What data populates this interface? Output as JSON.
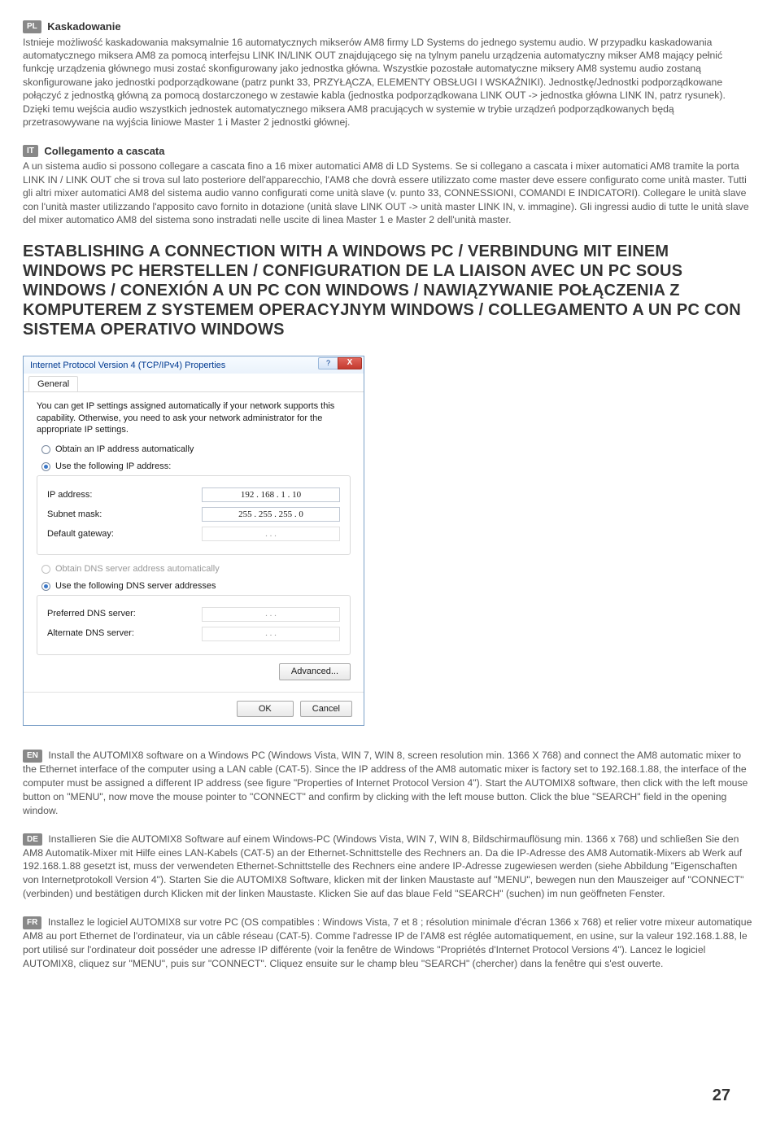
{
  "pl_section": {
    "badge": "PL",
    "title": "Kaskadowanie",
    "body": "Istnieje możliwość kaskadowania maksymalnie 16 automatycznych mikserów AM8 firmy LD Systems do jednego systemu audio. W przypadku kaskadowania automatycznego miksera AM8 za pomocą interfejsu LINK IN/LINK OUT znajdującego się na tylnym panelu urządzenia automatyczny mikser AM8 mający pełnić funkcję urządzenia głównego musi zostać skonfigurowany jako jednostka główna. Wszystkie pozostałe automatyczne miksery AM8 systemu audio zostaną skonfigurowane jako jednostki podporządkowane (patrz punkt 33, PRZYŁĄCZA, ELEMENTY OBSŁUGI I WSKAŹNIKI). Jednostkę/Jednostki podporządkowane połączyć z jednostką główną za pomocą dostarczonego w zestawie kabla (jednostka podporządkowana LINK OUT -> jednostka główna LINK IN, patrz rysunek). Dzięki temu wejścia audio wszystkich jednostek automatycznego miksera AM8 pracujących w systemie w trybie urządzeń podporządkowanych będą przetrasowywane na wyjścia liniowe Master 1 i Master 2 jednostki głównej."
  },
  "it_section": {
    "badge": "IT",
    "title": "Collegamento a cascata",
    "body": "A un sistema audio si possono collegare a cascata fino a 16 mixer automatici AM8 di LD Systems. Se si collegano a cascata i mixer automatici AM8 tramite la porta LINK IN / LINK OUT che si trova sul lato posteriore dell'apparecchio, l'AM8 che dovrà essere utilizzato come master deve essere configurato come unità master. Tutti gli altri mixer automatici AM8 del sistema audio vanno configurati come unità slave (v. punto 33, CONNESSIONI, COMANDI E INDICATORI). Collegare le unità slave con l'unità master utilizzando l'apposito cavo fornito in dotazione (unità slave LINK OUT -> unità master LINK IN, v. immagine). Gli ingressi audio di tutte le unità slave del mixer automatico AM8 del sistema sono instradati nelle uscite di linea Master 1 e Master 2 dell'unità master."
  },
  "big_heading": "ESTABLISHING A CONNECTION WITH A WINDOWS PC / VERBINDUNG MIT EINEM WINDOWS PC HERSTELLEN / CONFIGURATION DE LA LIAISON AVEC UN PC SOUS WINDOWS / CONEXIÓN A UN PC CON WINDOWS / NAWIĄZYWANIE POŁĄCZENIA Z KOMPUTEREM Z SYSTEMEM OPERACYJNYM WINDOWS / COLLEGAMENTO A UN PC CON SISTEMA OPERATIVO WINDOWS",
  "dialog": {
    "title": "Internet Protocol Version 4 (TCP/IPv4) Properties",
    "help_glyph": "?",
    "close_glyph": "X",
    "tab": "General",
    "desc": "You can get IP settings assigned automatically if your network supports this capability. Otherwise, you need to ask your network administrator for the appropriate IP settings.",
    "r1": "Obtain an IP address automatically",
    "r2": "Use the following IP address:",
    "ip_label": "IP address:",
    "ip_value": "192 . 168 .   1  .  10",
    "mask_label": "Subnet mask:",
    "mask_value": "255 . 255 . 255 .   0",
    "gw_label": "Default gateway:",
    "gw_value": ".        .        .",
    "r3": "Obtain DNS server address automatically",
    "r4": "Use the following DNS server addresses",
    "dns1_label": "Preferred DNS server:",
    "dns1_value": ".        .        .",
    "dns2_label": "Alternate DNS server:",
    "dns2_value": ".        .        .",
    "advanced": "Advanced...",
    "ok": "OK",
    "cancel": "Cancel"
  },
  "en": {
    "badge": "EN",
    "body": "Install the AUTOMIX8 software on a Windows PC (Windows Vista, WIN 7, WIN 8, screen resolution min. 1366 X 768) and connect the AM8 automatic mixer to the Ethernet interface of the computer using a LAN cable (CAT-5). Since the IP address of the AM8 automatic mixer is factory set to 192.168.1.88, the interface of the computer must be assigned a different IP address (see figure \"Properties of Internet Protocol Version 4\"). Start the AUTOMIX8 software, then click with the left mouse button on \"MENU\", now move the mouse pointer to \"CONNECT\" and confirm by clicking with the left mouse button. Click the blue \"SEARCH\" field in the opening window."
  },
  "de": {
    "badge": "DE",
    "body": "Installieren Sie die AUTOMIX8 Software auf einem Windows-PC (Windows Vista, WIN 7, WIN 8, Bildschirmauflösung min. 1366 x 768) und schließen Sie den AM8 Automatik-Mixer mit Hilfe eines LAN-Kabels (CAT-5) an der Ethernet-Schnittstelle des Rechners an. Da die IP-Adresse des AM8 Automatik-Mixers ab Werk auf 192.168.1.88 gesetzt ist, muss der verwendeten Ethernet-Schnittstelle des Rechners eine andere IP-Adresse zugewiesen werden (siehe Abbildung \"Eigenschaften von Internetprotokoll Version 4\"). Starten Sie die AUTOMIX8 Software, klicken mit der linken Maustaste auf \"MENU\", bewegen nun den Mauszeiger auf \"CONNECT\" (verbinden) und bestätigen durch Klicken mit der linken Maustaste. Klicken Sie auf das blaue Feld \"SEARCH\" (suchen) im nun geöffneten Fenster."
  },
  "fr": {
    "badge": "FR",
    "body": "Installez le logiciel AUTOMIX8 sur votre PC (OS compatibles : Windows Vista, 7 et 8 ; résolution minimale d'écran 1366 x 768) et relier votre mixeur automatique AM8 au port Ethernet de l'ordinateur, via un câble réseau (CAT-5). Comme l'adresse IP de l'AM8 est réglée automatiquement, en usine, sur la valeur 192.168.1.88, le port utilisé sur l'ordinateur doit posséder une adresse IP différente (voir la fenêtre de Windows \"Propriétés d'Internet Protocol Versions 4\"). Lancez le logiciel AUTOMIX8, cliquez sur \"MENU\", puis sur \"CONNECT\".  Cliquez ensuite sur le champ bleu \"SEARCH\" (chercher) dans la fenêtre qui s'est ouverte."
  },
  "page_number": "27"
}
